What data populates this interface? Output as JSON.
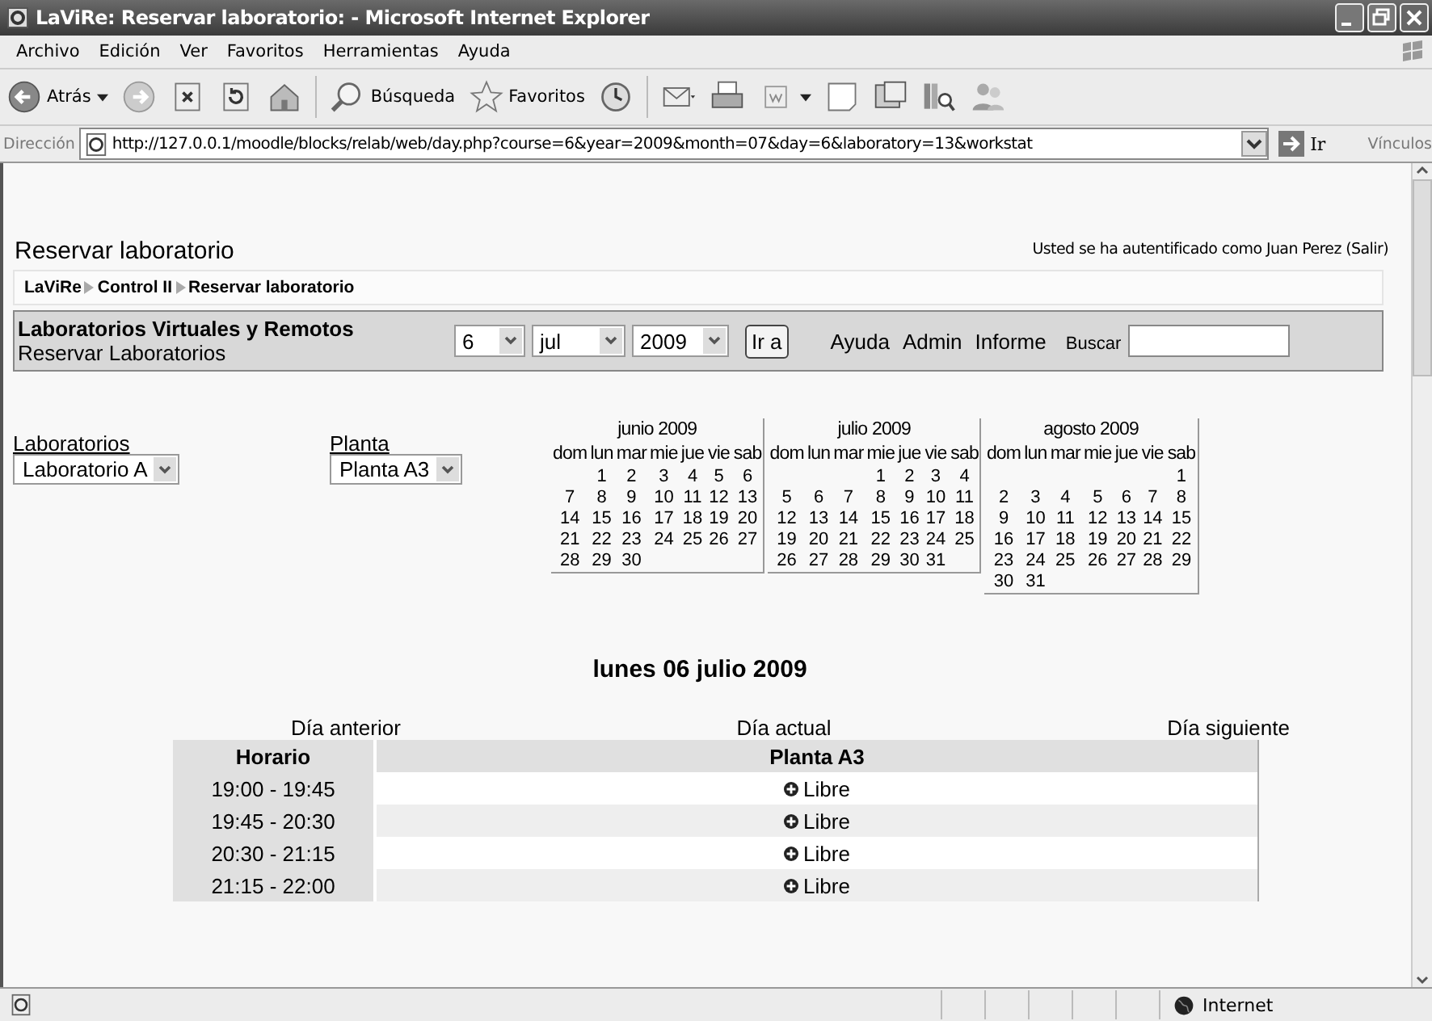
{
  "window": {
    "title": "LaViRe: Reservar laboratorio: - Microsoft Internet Explorer"
  },
  "menu": [
    "Archivo",
    "Edición",
    "Ver",
    "Favoritos",
    "Herramientas",
    "Ayuda"
  ],
  "toolbar": {
    "back": "Atrás",
    "search": "Búsqueda",
    "favorites": "Favoritos"
  },
  "address": {
    "label": "Dirección",
    "url": "http://127.0.0.1/moodle/blocks/relab/web/day.php?course=6&year=2009&month=07&day=6&laboratory=13&workstat",
    "go": "Ir",
    "links": "Vínculos"
  },
  "page": {
    "title": "Reservar laboratorio",
    "login_text": "Usted se ha autentificado como Juan Perez (",
    "logout": "Salir",
    "login_end": ")"
  },
  "breadcrumb": [
    "LaViRe",
    "Control II",
    "Reservar laboratorio"
  ],
  "header": {
    "title": "Laboratorios Virtuales y Remotos",
    "subtitle": "Reservar Laboratorios",
    "day": "6",
    "month": "jul",
    "year": "2009",
    "go": "Ir a",
    "links": [
      "Ayuda",
      "Admin",
      "Informe"
    ],
    "search_label": "Buscar"
  },
  "filters": [
    {
      "label": "Laboratorios",
      "value": "Laboratorio A"
    },
    {
      "label": "Planta",
      "value": "Planta A3"
    }
  ],
  "calendars": [
    {
      "title": "junio 2009",
      "weekdays": [
        "dom",
        "lun",
        "mar",
        "mie",
        "jue",
        "vie",
        "sab"
      ],
      "weeks": [
        [
          "1",
          "2",
          "3",
          "4",
          "5",
          "6"
        ],
        [
          "7",
          "8",
          "9",
          "10",
          "11",
          "12",
          "13"
        ],
        [
          "14",
          "15",
          "16",
          "17",
          "18",
          "19",
          "20"
        ],
        [
          "21",
          "22",
          "23",
          "24",
          "25",
          "26",
          "27"
        ],
        [
          "28",
          "29",
          "30"
        ]
      ]
    },
    {
      "title": "julio 2009",
      "weekdays": [
        "dom",
        "lun",
        "mar",
        "mie",
        "jue",
        "vie",
        "sab"
      ],
      "weeks": [
        [
          "1",
          "2",
          "3",
          "4"
        ],
        [
          "5",
          "6",
          "7",
          "8",
          "9",
          "10",
          "11"
        ],
        [
          "12",
          "13",
          "14",
          "15",
          "16",
          "17",
          "18"
        ],
        [
          "19",
          "20",
          "21",
          "22",
          "23",
          "24",
          "25"
        ],
        [
          "26",
          "27",
          "28",
          "29",
          "30",
          "31"
        ]
      ]
    },
    {
      "title": "agosto 2009",
      "weekdays": [
        "dom",
        "lun",
        "mar",
        "mie",
        "jue",
        "vie",
        "sab"
      ],
      "weeks": [
        [
          "1"
        ],
        [
          "2",
          "3",
          "4",
          "5",
          "6",
          "7",
          "8"
        ],
        [
          "9",
          "10",
          "11",
          "12",
          "13",
          "14",
          "15"
        ],
        [
          "16",
          "17",
          "18",
          "19",
          "20",
          "21",
          "22"
        ],
        [
          "23",
          "24",
          "25",
          "26",
          "27",
          "28",
          "29"
        ],
        [
          "30",
          "31"
        ]
      ]
    }
  ],
  "day_title": "lunes 06 julio 2009",
  "day_nav": [
    "Día anterior",
    "Día actual",
    "Día siguiente"
  ],
  "schedule": {
    "columns": [
      "Horario",
      "Planta A3"
    ],
    "rows": [
      {
        "time": "19:00 - 19:45",
        "status": "Libre"
      },
      {
        "time": "19:45 - 20:30",
        "status": "Libre"
      },
      {
        "time": "20:30 - 21:15",
        "status": "Libre"
      },
      {
        "time": "21:15 - 22:00",
        "status": "Libre"
      }
    ]
  },
  "status_bar": {
    "zone": "Internet"
  }
}
